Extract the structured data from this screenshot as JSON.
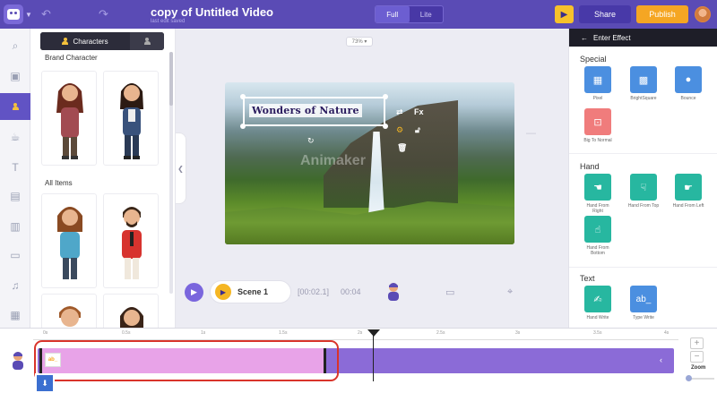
{
  "topbar": {
    "title": "copy of Untitled Video",
    "subtitle": "last edit saved",
    "mode_full": "Full",
    "mode_lite": "Lite",
    "share": "Share",
    "publish": "Publish",
    "play_icon": "play-icon",
    "undo_icon": "undo-icon",
    "redo_icon": "redo-icon"
  },
  "rail": {
    "items": [
      "search-icon",
      "image-icon",
      "character-icon",
      "coffee-cup-icon",
      "text-icon",
      "bg-icon",
      "chart-icon",
      "layout-icon",
      "music-icon",
      "video-icon"
    ],
    "active": "character-icon"
  },
  "panel": {
    "tab_characters": "Characters",
    "brand_heading": "Brand Character",
    "all_heading": "All Items"
  },
  "canvas": {
    "zoom": "73%",
    "text_element": "Wonders of Nature",
    "watermark": "Animaker",
    "fx_label": "Fx"
  },
  "scene": {
    "name": "Scene 1",
    "time_total": "[00:02.1]",
    "time_current": "00:04"
  },
  "effects": {
    "back_label": "Enter Effect",
    "sections": [
      {
        "title": "Special",
        "items": [
          {
            "label": "Pixel",
            "color": "#4b8fe0",
            "glyph": "▦"
          },
          {
            "label": "BrightSquare",
            "color": "#4b8fe0",
            "glyph": "▩"
          },
          {
            "label": "Bounce",
            "color": "#4b8fe0",
            "glyph": "●"
          },
          {
            "label": "Big To Normal",
            "color": "#f07c7c",
            "glyph": "⊡"
          }
        ]
      },
      {
        "title": "Hand",
        "items": [
          {
            "label": "Hand From Right",
            "color": "#27b7a0",
            "glyph": "☚"
          },
          {
            "label": "Hand From Top",
            "color": "#27b7a0",
            "glyph": "☟"
          },
          {
            "label": "Hand From Left",
            "color": "#27b7a0",
            "glyph": "☛"
          },
          {
            "label": "Hand From Bottom",
            "color": "#27b7a0",
            "glyph": "☝"
          }
        ]
      },
      {
        "title": "Text",
        "items": [
          {
            "label": "Hand Write",
            "color": "#27b7a0",
            "glyph": "✍"
          },
          {
            "label": "Type Write",
            "color": "#4b8fe0",
            "glyph": "ab_"
          }
        ]
      }
    ]
  },
  "timeline": {
    "ticks": [
      "0s",
      "0.5s",
      "1s",
      "1.5s",
      "2s",
      "2.5s",
      "3s",
      "3.5s",
      "4s"
    ],
    "clip_thumb": "ab_",
    "zoom_label": "Zoom",
    "zoom_in": "+",
    "zoom_out": "−"
  },
  "colors": {
    "brand": "#5a4bb5",
    "accent_orange": "#f5a623",
    "track": "#8b6bd7",
    "clip": "#e8a3e8",
    "highlight": "#d9342b"
  }
}
